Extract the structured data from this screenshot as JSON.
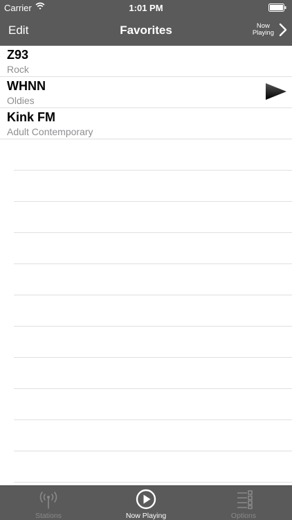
{
  "status_bar": {
    "carrier": "Carrier",
    "time": "1:01 PM"
  },
  "nav": {
    "edit_label": "Edit",
    "title": "Favorites",
    "now_playing_line1": "Now",
    "now_playing_line2": "Playing"
  },
  "stations": [
    {
      "name": "Z93",
      "genre": "Rock",
      "playing": false
    },
    {
      "name": "WHNN",
      "genre": "Oldies",
      "playing": true
    },
    {
      "name": "Kink FM",
      "genre": "Adult Contemporary",
      "playing": false
    }
  ],
  "tabbar": {
    "tabs": [
      {
        "label": "Stations",
        "icon": "antenna-icon",
        "active": false
      },
      {
        "label": "Now Playing",
        "icon": "play-circle-icon",
        "active": true
      },
      {
        "label": "Options",
        "icon": "options-list-icon",
        "active": false
      }
    ]
  },
  "colors": {
    "bar": "#5a5a5a",
    "separator": "#e0e0e0",
    "subtitle": "#8e8e93"
  }
}
